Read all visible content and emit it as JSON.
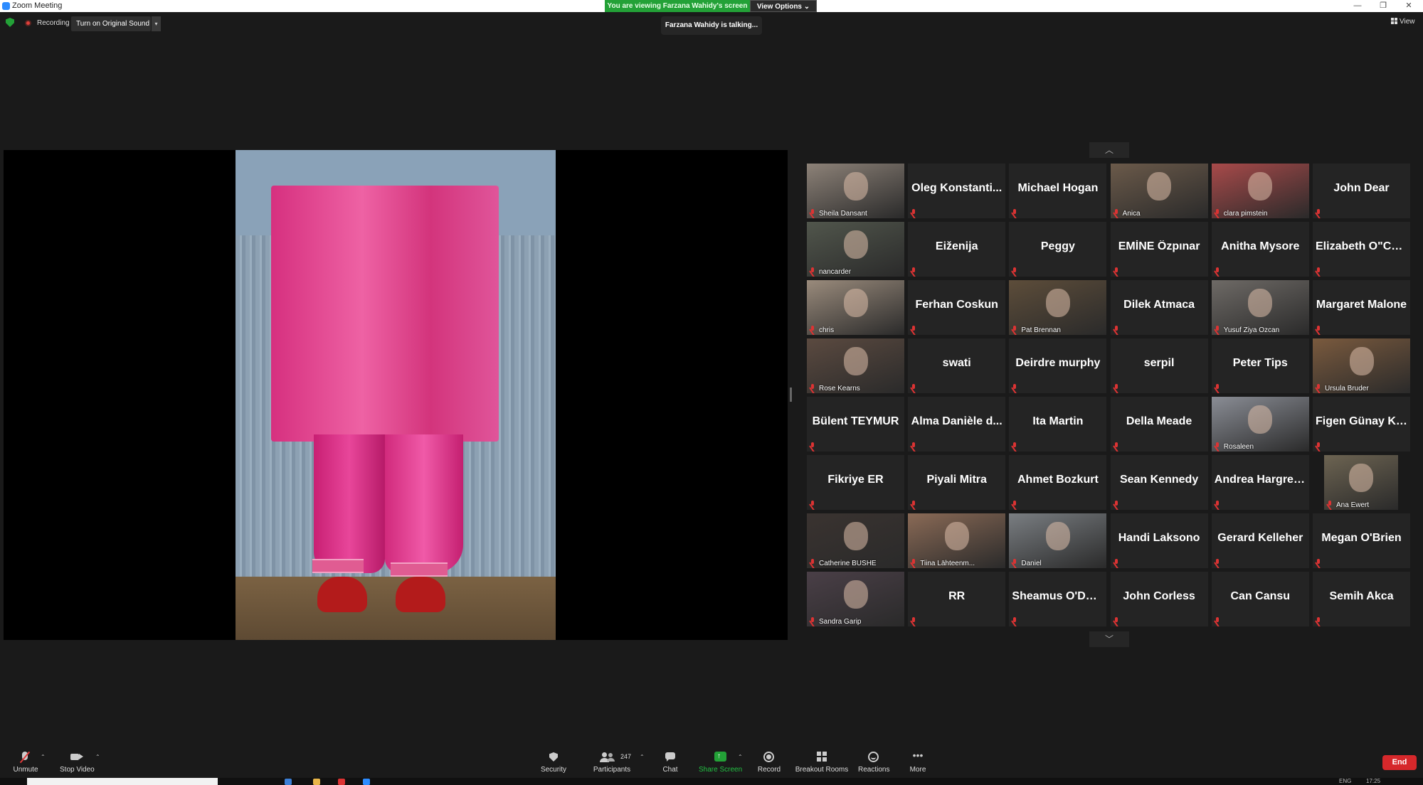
{
  "window": {
    "title": "Zoom Meeting",
    "minimize": "—",
    "restore": "❐",
    "close": "✕"
  },
  "banner": {
    "viewing": "You are viewing Farzana Wahidy's screen",
    "view_options": "View Options ⌄"
  },
  "talking": "Farzana Wahidy is talking...",
  "status": {
    "recording": "Recording",
    "original_sound": "Turn on Original Sound",
    "caret": "▾"
  },
  "view": "View",
  "nav": {
    "up": "︿",
    "down": "﹀"
  },
  "participants": [
    {
      "name": "Sheila Dansant",
      "video": true,
      "bg": "#8d8278"
    },
    {
      "name": "Oleg  Konstanti...",
      "video": false
    },
    {
      "name": "Michael Hogan",
      "video": false
    },
    {
      "name": "Anica",
      "video": true,
      "bg": "#6b5a4a"
    },
    {
      "name": "clara pimstein",
      "video": true,
      "bg": "#a84a4a"
    },
    {
      "name": "John Dear",
      "video": false
    },
    {
      "name": "nancarder",
      "video": true,
      "bg": "#51564c"
    },
    {
      "name": "Eiženija",
      "video": false
    },
    {
      "name": "Peggy",
      "video": false
    },
    {
      "name": "EMİNE Özpınar",
      "video": false
    },
    {
      "name": "Anitha Mysore",
      "video": false
    },
    {
      "name": "Elizabeth  O\"Co...",
      "video": false
    },
    {
      "name": "chris",
      "video": true,
      "bg": "#9a8b7c"
    },
    {
      "name": "Ferhan Coskun",
      "video": false
    },
    {
      "name": "Pat Brennan",
      "video": true,
      "bg": "#5d4d3a"
    },
    {
      "name": "Dilek Atmaca",
      "video": false
    },
    {
      "name": "Yusuf Ziya Ozcan",
      "video": true,
      "bg": "#6e6a66"
    },
    {
      "name": "Margaret Malone",
      "video": false
    },
    {
      "name": "Rose Kearns",
      "video": true,
      "bg": "#5b4a40"
    },
    {
      "name": "swati",
      "video": false
    },
    {
      "name": "Deirdre murphy",
      "video": false
    },
    {
      "name": "serpil",
      "video": false
    },
    {
      "name": "Peter Tips",
      "video": false
    },
    {
      "name": "Ursula Bruder",
      "video": true,
      "bg": "#7a5a3e"
    },
    {
      "name": "Bülent TEYMUR",
      "video": false
    },
    {
      "name": "Alma  Danièle  d...",
      "video": false
    },
    {
      "name": "Ita Martin",
      "video": false
    },
    {
      "name": "Della Meade",
      "video": false
    },
    {
      "name": "Rosaleen",
      "video": true,
      "bg": "#8a8d95"
    },
    {
      "name": "Figen Günay Kılıç",
      "video": false
    },
    {
      "name": "Fikriye ER",
      "video": false
    },
    {
      "name": "Piyali Mitra",
      "video": false
    },
    {
      "name": "Ahmet Bozkurt",
      "video": false
    },
    {
      "name": "Sean Kennedy",
      "video": false
    },
    {
      "name": "Andrea  Hargrea...",
      "video": false
    },
    {
      "name": "Ana Ewert",
      "video": true,
      "bg": "#6d6452",
      "narrow": true
    },
    {
      "name": "Catherine BUSHE",
      "video": true,
      "bg": "#3a3330"
    },
    {
      "name": "Tiina Lähteenm...",
      "video": true,
      "bg": "#8a6a56"
    },
    {
      "name": "Daniel",
      "video": true,
      "bg": "#7a7e82"
    },
    {
      "name": "Handi Laksono",
      "video": false
    },
    {
      "name": "Gerard Kelleher",
      "video": false
    },
    {
      "name": "Megan O'Brien",
      "video": false
    },
    {
      "name": "Sandra Garip",
      "video": true,
      "bg": "#4a3f47"
    },
    {
      "name": "RR",
      "video": false
    },
    {
      "name": "Sheamus  O'Don...",
      "video": false
    },
    {
      "name": "John Corless",
      "video": false
    },
    {
      "name": "Can Cansu",
      "video": false
    },
    {
      "name": "Semih Akca",
      "video": false
    }
  ],
  "toolbar": {
    "unmute": "Unmute",
    "stop_video": "Stop Video",
    "security": "Security",
    "participants": "Participants",
    "participant_count": "247",
    "chat": "Chat",
    "share_screen": "Share Screen",
    "record": "Record",
    "breakout_rooms": "Breakout Rooms",
    "reactions": "Reactions",
    "more": "More",
    "end": "End"
  },
  "taskbar": {
    "lang": "ENG",
    "time": "17:25"
  },
  "colors": {
    "share_green": "#23a137",
    "end_red": "#d6282b",
    "mute_red": "#d33333"
  }
}
